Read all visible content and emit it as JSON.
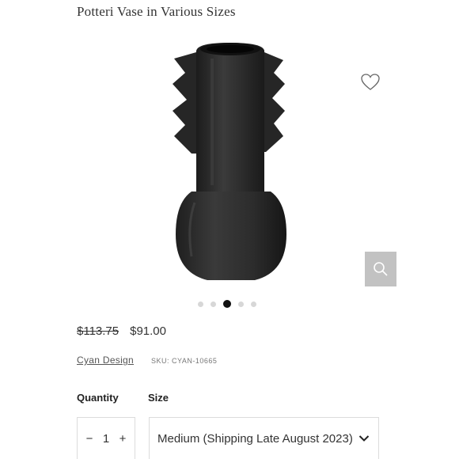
{
  "product": {
    "title": "Potteri Vase in Various Sizes",
    "old_price": "$113.75",
    "price": "$91.00",
    "brand": "Cyan Design",
    "sku": "SKU: CYAN-10665"
  },
  "gallery": {
    "slide_count": 5,
    "active_slide": 3,
    "image_icon": "vase-image",
    "wishlist_icon": "heart-icon",
    "zoom_icon": "magnifier-icon"
  },
  "purchase": {
    "quantity_label": "Quantity",
    "size_label": "Size",
    "decrement": "−",
    "quantity": "1",
    "increment": "+",
    "size_value": "Medium (Shipping Late August 2023)"
  },
  "colors": {
    "vase": "#2a2a2a",
    "zoom_bg": "#c2c2c2",
    "active_dot": "#111111",
    "inactive_dot": "#d7d7d7"
  }
}
